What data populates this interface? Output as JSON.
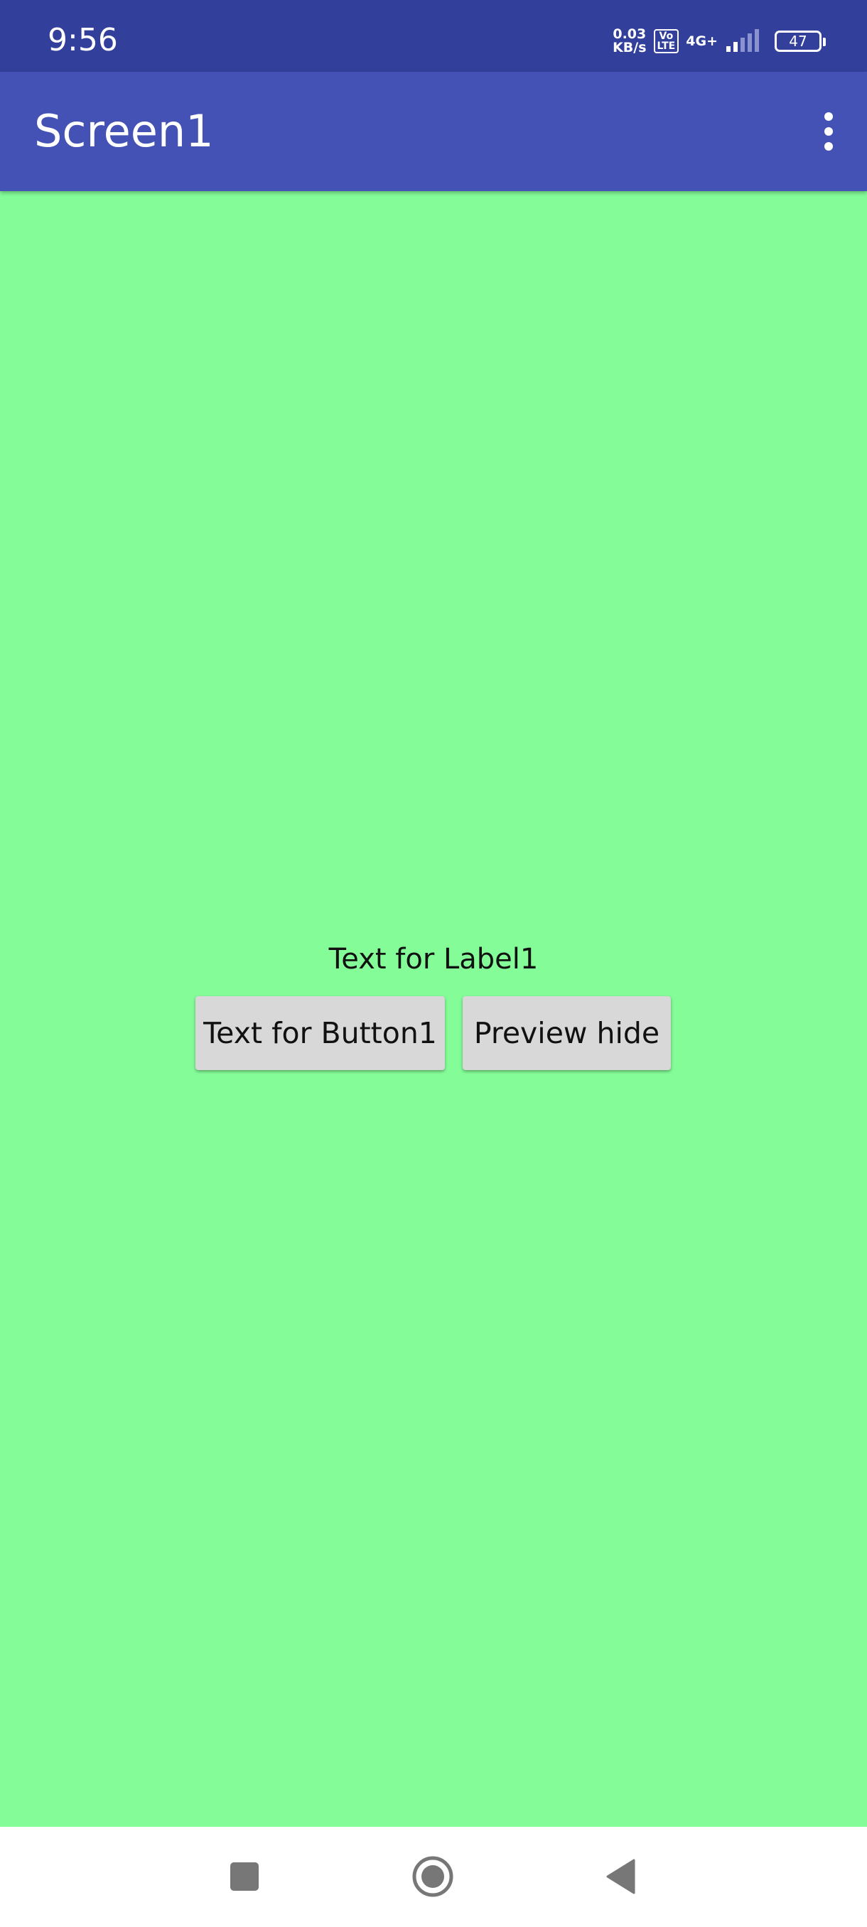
{
  "status_bar": {
    "time": "9:56",
    "net_speed_value": "0.03",
    "net_speed_unit": "KB/s",
    "volte_top": "Vo",
    "volte_bottom": "LTE",
    "network_type": "4G+",
    "battery_level": "47"
  },
  "app_bar": {
    "title": "Screen1",
    "menu_icon": "more-vert-icon"
  },
  "content": {
    "background_color": "#84fd98",
    "label1": "Text for Label1",
    "button1_label": "Text for Button1",
    "button2_label": "Preview hide"
  },
  "nav_bar": {
    "recents_icon": "square-icon",
    "home_icon": "circle-icon",
    "back_icon": "triangle-back-icon"
  },
  "colors": {
    "status_bar": "#32409c",
    "app_bar": "#4452b5",
    "button": "#d8d8d8"
  }
}
